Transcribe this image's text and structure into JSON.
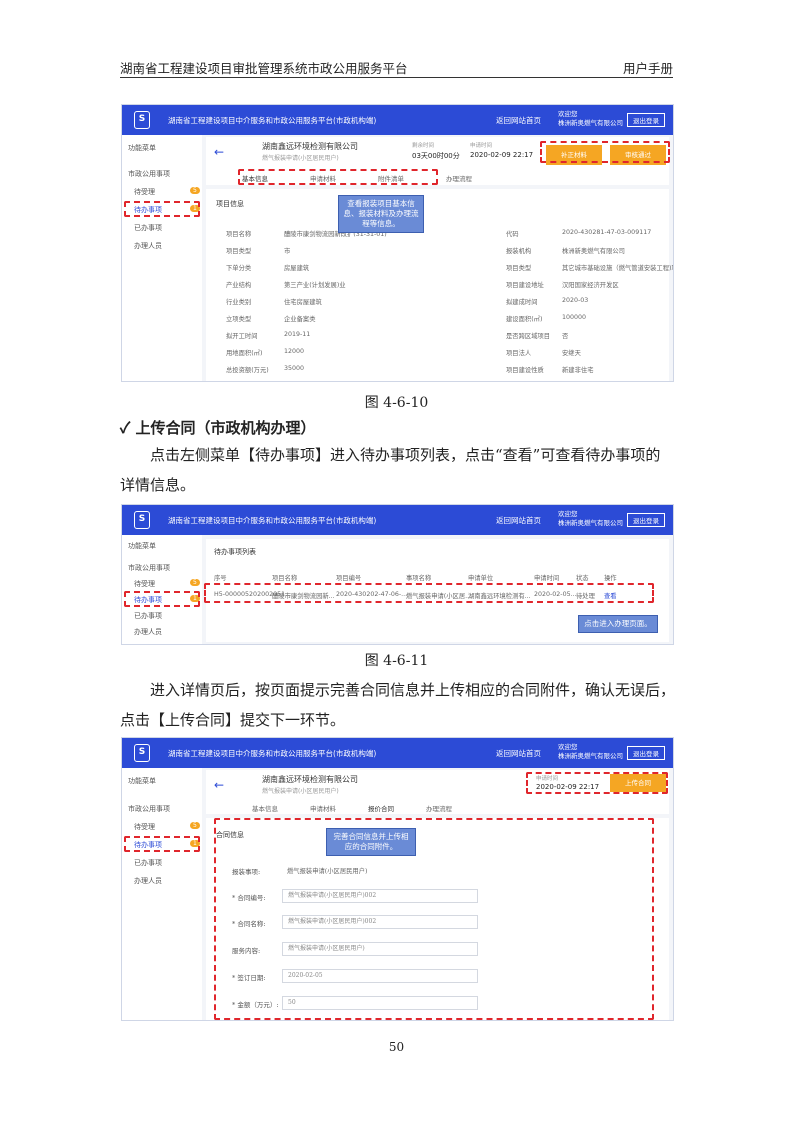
{
  "header": {
    "left": "湖南省工程建设项目审批管理系统市政公用服务平台",
    "right": "用户手册"
  },
  "app": {
    "title": "湖南省工程建设项目中介服务和市政公用服务平台(市政机构端)",
    "home": "返回网站首页",
    "welcome": "欢迎您",
    "user": "株洲新奥燃气有限公司",
    "logout": "退出登录",
    "menu": "功能菜单",
    "group": "市政公用事项",
    "pending": "待受理",
    "todo": "待办事项",
    "done": "已办事项",
    "staff": "办理人员",
    "badge1": "5",
    "badge2": "1"
  },
  "s1": {
    "company": "湖南鑫远环境检测有限公司",
    "sub": "燃气报装申请(小区居民用户)",
    "t1label": "剩余时间",
    "t1": "03天00时00分",
    "t2label": "申请时间",
    "t2": "2020-02-09 22:17",
    "btn1": "补正材料",
    "btn2": "审核通过",
    "tabs": [
      "基本信息",
      "申请材料",
      "附件清单",
      "办理流程"
    ],
    "section": "项目信息",
    "tip": "查看报装项目基本信息、报装材料及办理流程等信息。",
    "rows": [
      [
        "项目名称",
        "醴陵市康剑物流园新改扩(31-31-01)",
        "代码",
        "2020-430281-47-03-009117"
      ],
      [
        "项目类型",
        "市",
        "报装机构",
        "株洲新奥燃气有限公司"
      ],
      [
        "下单分类",
        "房屋建筑",
        "项目类型",
        "其它城市基础设施（燃气管道安装工程)项目"
      ],
      [
        "产业结构",
        "第三产业(计划发展)业",
        "项目建设地址",
        "汉阳国家经济开发区"
      ],
      [
        "行业类别",
        "住宅房屋建筑",
        "拟建成时间",
        "2020-03"
      ],
      [
        "立项类型",
        "企业备案类",
        "建设面积(㎡)",
        "100000"
      ],
      [
        "拟开工时间",
        "2019-11",
        "是否跨区域项目",
        "否"
      ],
      [
        "用地面积(㎡)",
        "12000",
        "项目法人",
        "安继天"
      ],
      [
        "总投资额(万元)",
        "35000",
        "项目建设性质",
        "新建非住宅"
      ]
    ]
  },
  "cap1": "图 4-6-10",
  "h2": "✓ 上传合同（市政机构办理）",
  "p1": "点击左侧菜单【待办事项】进入待办事项列表，点击“查看”可查看待办事项的详情信息。",
  "s2": {
    "section": "待办事项列表",
    "cols": [
      "序号",
      "项目名称",
      "项目编号",
      "事项名称",
      "申请单位",
      "申请时间",
      "状态",
      "操作"
    ],
    "row": [
      "H5-000005202002051...",
      "醴陵市康剑物流园新...",
      "2020-430202-47-06-...",
      "燃气报装申请(小区居...",
      "湖南鑫远环境检测有...",
      "2020-02-05...",
      "待处理",
      "查看"
    ],
    "tip": "点击进入办理页面。"
  },
  "cap2": "图 4-6-11",
  "p2": "进入详情页后，按页面提示完善合同信息并上传相应的合同附件，确认无误后，点击【上传合同】提交下一环节。",
  "s3": {
    "company": "湖南鑫远环境检测有限公司",
    "sub": "燃气报装申请(小区居民用户)",
    "tlabel": "申请时间",
    "t": "2020-02-09 22:17",
    "btn": "上传合同",
    "tabs": [
      "基本信息",
      "申请材料",
      "报价合同",
      "办理流程"
    ],
    "section": "合同信息",
    "tip": "完善合同信息并上传相应的合同附件。",
    "f0l": "报装事项:",
    "f0": "燃气报装申请(小区居民用户)",
    "f1l": "合同编号:",
    "f1": "燃气报装申请(小区居民用户)002",
    "f2l": "合同名称:",
    "f2": "燃气报装申请(小区居民用户)002",
    "f3l": "服务内容:",
    "f3": "燃气报装申请(小区居民用户)",
    "f4l": "签订日期:",
    "f4": "2020-02-05",
    "f5l": "金额（万元）:",
    "f5": "50"
  },
  "page": "50"
}
